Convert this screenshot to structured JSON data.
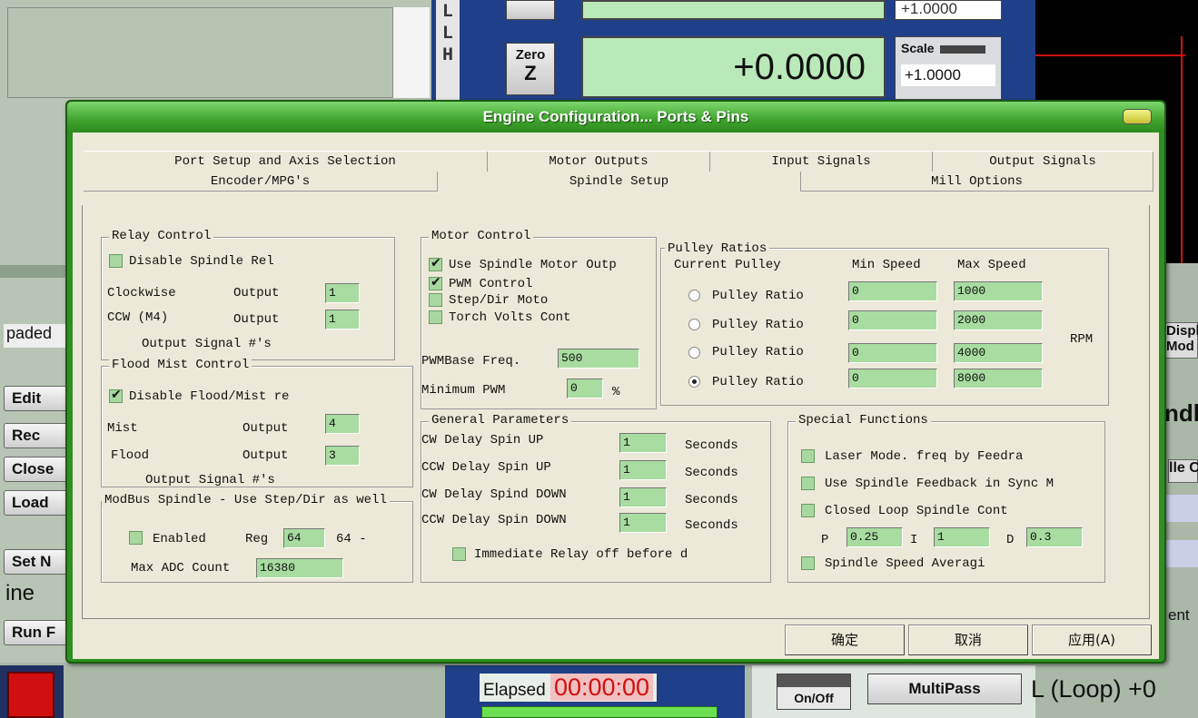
{
  "background": {
    "dro_letters": [
      "L",
      "L",
      "H"
    ],
    "zero_button": {
      "line1": "Zero",
      "line2": "Z"
    },
    "dro_value": "+0.0000",
    "dro_top_value": "",
    "scale_label": "Scale",
    "scale_value": "+1.0000",
    "scale_top_value": "+1.0000",
    "left_text_loaded": "paded",
    "left_buttons": [
      "Edit",
      "Rec",
      "Close",
      "Load",
      "Set N",
      "Run F"
    ],
    "left_text_ine": "ine",
    "right_text_displ": "Displ",
    "right_text_mod": "Mod",
    "right_text_ndl": "ndl",
    "right_text_lec": "lle C",
    "right_text_ent": "ent",
    "elapsed_label": "Elapsed",
    "elapsed_value": "00:00:00",
    "onoff_label": "On/Off",
    "multipass_label": "MultiPass",
    "loop_label": "L (Loop)",
    "loop_value": "+0"
  },
  "dialog": {
    "title": "Engine Configuration... Ports & Pins",
    "tabs_row1": [
      "Port Setup and Axis Selection",
      "Motor Outputs",
      "Input Signals",
      "Output Signals"
    ],
    "tabs_row2": [
      "Encoder/MPG's",
      "Spindle Setup",
      "Mill Options"
    ],
    "active_tab": "Spindle Setup",
    "relay_control": {
      "title": "Relay Control",
      "disable_label": "Disable Spindle Rel",
      "disable_checked": false,
      "cw_label": "Clockwise",
      "ccw_label": "CCW (M4)",
      "output_label": "Output",
      "cw_output": "1",
      "ccw_output": "1",
      "signal_note": "Output Signal #'s"
    },
    "flood_mist": {
      "title": "Flood Mist Control",
      "disable_label": "Disable Flood/Mist re",
      "disable_checked": true,
      "mist_label": "Mist",
      "flood_label": "Flood",
      "output_label": "Output",
      "mist_output": "4",
      "flood_output": "3",
      "signal_note": "Output Signal #'s"
    },
    "modbus": {
      "title": "ModBus Spindle - Use Step/Dir as well",
      "enabled_label": "Enabled",
      "enabled_checked": false,
      "reg_label": "Reg",
      "reg_value": "64",
      "reg_suffix": "64 -",
      "max_adc_label": "Max ADC Count",
      "max_adc_value": "16380"
    },
    "motor_control": {
      "title": "Motor Control",
      "options": [
        {
          "label": "Use Spindle Motor Outp",
          "checked": true
        },
        {
          "label": "PWM Control",
          "checked": true
        },
        {
          "label": "Step/Dir Moto",
          "checked": false
        },
        {
          "label": "Torch Volts Cont",
          "checked": false
        }
      ],
      "pwm_base_label": "PWMBase Freq.",
      "pwm_base_value": "500",
      "min_pwm_label": "Minimum PWM",
      "min_pwm_value": "0",
      "min_pwm_unit": "%"
    },
    "pulley_ratios": {
      "title": "Pulley Ratios",
      "current_label": "Current Pulley",
      "min_label": "Min Speed",
      "max_label": "Max Speed",
      "rpm_label": "RPM",
      "rows": [
        {
          "label": "Pulley Ratio",
          "min": "0",
          "max": "1000",
          "selected": false
        },
        {
          "label": "Pulley Ratio",
          "min": "0",
          "max": "2000",
          "selected": false
        },
        {
          "label": "Pulley Ratio",
          "min": "0",
          "max": "4000",
          "selected": false
        },
        {
          "label": "Pulley Ratio",
          "min": "0",
          "max": "8000",
          "selected": true
        }
      ]
    },
    "general": {
      "title": "General Parameters",
      "rows": [
        {
          "label": "CW Delay Spin UP",
          "value": "1",
          "unit": "Seconds"
        },
        {
          "label": "CCW Delay Spin UP",
          "value": "1",
          "unit": "Seconds"
        },
        {
          "label": "CW Delay Spind DOWN",
          "value": "1",
          "unit": "Seconds"
        },
        {
          "label": "CCW Delay Spin DOWN",
          "value": "1",
          "unit": "Seconds"
        }
      ],
      "immediate_label": "Immediate Relay off before d",
      "immediate_checked": false
    },
    "special": {
      "title": "Special Functions",
      "laser_label": "Laser Mode. freq by Feedra",
      "feedback_label": "Use Spindle Feedback in Sync M",
      "closed_loop_label": "Closed Loop Spindle Cont",
      "p_label": "P",
      "p_value": "0.25",
      "i_label": "I",
      "i_value": "1",
      "d_label": "D",
      "d_value": "0.3",
      "averaging_label": "Spindle Speed Averagi"
    },
    "buttons": {
      "ok": "确定",
      "cancel": "取消",
      "apply": "应用(A)"
    }
  }
}
